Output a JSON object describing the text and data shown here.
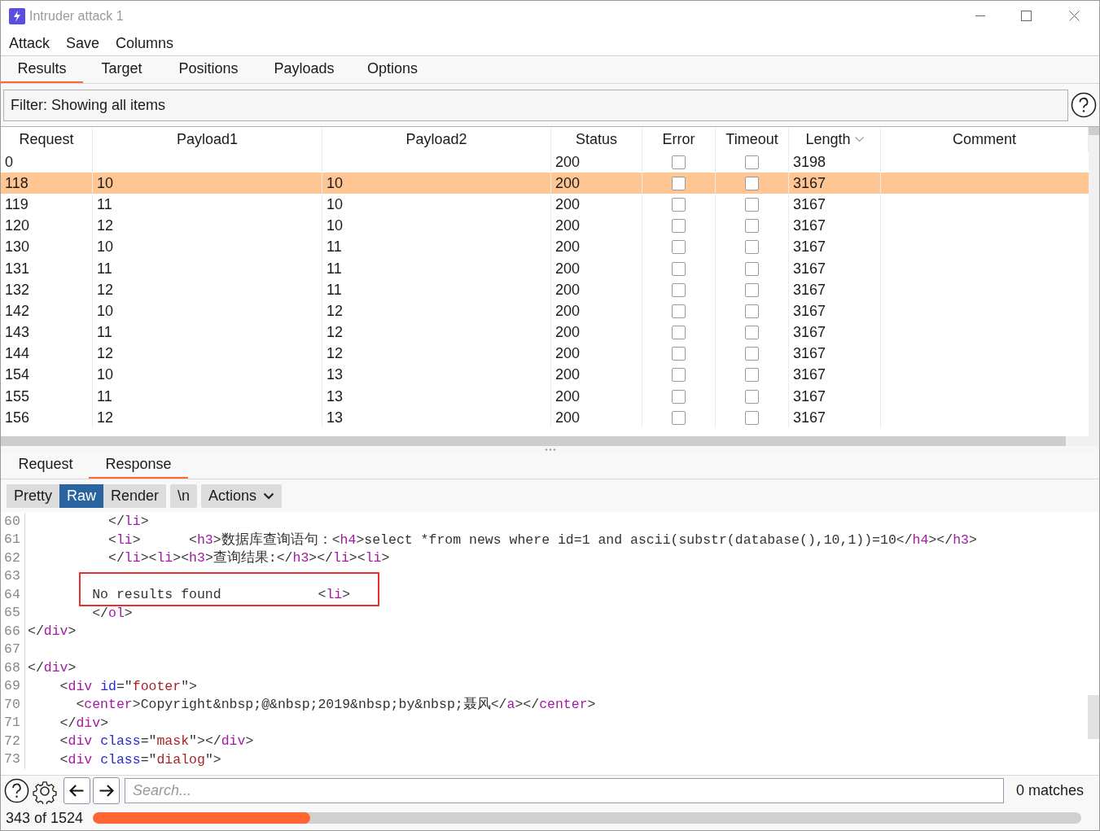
{
  "window": {
    "title": "Intruder attack 1"
  },
  "menu": [
    "Attack",
    "Save",
    "Columns"
  ],
  "tabs": [
    {
      "label": "Results",
      "selected": true
    },
    {
      "label": "Target",
      "selected": false
    },
    {
      "label": "Positions",
      "selected": false
    },
    {
      "label": "Payloads",
      "selected": false
    },
    {
      "label": "Options",
      "selected": false
    }
  ],
  "filter": {
    "label": "Filter: Showing all items"
  },
  "table": {
    "columns": [
      {
        "label": "Request",
        "sorted": false
      },
      {
        "label": "Payload1",
        "sorted": false
      },
      {
        "label": "Payload2",
        "sorted": false
      },
      {
        "label": "Status",
        "sorted": false
      },
      {
        "label": "Error",
        "sorted": false
      },
      {
        "label": "Timeout",
        "sorted": false
      },
      {
        "label": "Length",
        "sorted": true
      },
      {
        "label": "Comment",
        "sorted": false
      }
    ],
    "rows": [
      {
        "request": "0",
        "payload1": "",
        "payload2": "",
        "status": "200",
        "error": false,
        "timeout": false,
        "length": "3198",
        "selected": false
      },
      {
        "request": "118",
        "payload1": "10",
        "payload2": "10",
        "status": "200",
        "error": false,
        "timeout": false,
        "length": "3167",
        "selected": true
      },
      {
        "request": "119",
        "payload1": "11",
        "payload2": "10",
        "status": "200",
        "error": false,
        "timeout": false,
        "length": "3167",
        "selected": false
      },
      {
        "request": "120",
        "payload1": "12",
        "payload2": "10",
        "status": "200",
        "error": false,
        "timeout": false,
        "length": "3167",
        "selected": false
      },
      {
        "request": "130",
        "payload1": "10",
        "payload2": "11",
        "status": "200",
        "error": false,
        "timeout": false,
        "length": "3167",
        "selected": false
      },
      {
        "request": "131",
        "payload1": "11",
        "payload2": "11",
        "status": "200",
        "error": false,
        "timeout": false,
        "length": "3167",
        "selected": false
      },
      {
        "request": "132",
        "payload1": "12",
        "payload2": "11",
        "status": "200",
        "error": false,
        "timeout": false,
        "length": "3167",
        "selected": false
      },
      {
        "request": "142",
        "payload1": "10",
        "payload2": "12",
        "status": "200",
        "error": false,
        "timeout": false,
        "length": "3167",
        "selected": false
      },
      {
        "request": "143",
        "payload1": "11",
        "payload2": "12",
        "status": "200",
        "error": false,
        "timeout": false,
        "length": "3167",
        "selected": false
      },
      {
        "request": "144",
        "payload1": "12",
        "payload2": "12",
        "status": "200",
        "error": false,
        "timeout": false,
        "length": "3167",
        "selected": false
      },
      {
        "request": "154",
        "payload1": "10",
        "payload2": "13",
        "status": "200",
        "error": false,
        "timeout": false,
        "length": "3167",
        "selected": false
      },
      {
        "request": "155",
        "payload1": "11",
        "payload2": "13",
        "status": "200",
        "error": false,
        "timeout": false,
        "length": "3167",
        "selected": false
      },
      {
        "request": "156",
        "payload1": "12",
        "payload2": "13",
        "status": "200",
        "error": false,
        "timeout": false,
        "length": "3167",
        "selected": false
      }
    ]
  },
  "message_tabs": [
    {
      "label": "Request",
      "selected": false
    },
    {
      "label": "Response",
      "selected": true
    }
  ],
  "view_buttons": [
    {
      "label": "Pretty",
      "selected": false
    },
    {
      "label": "Raw",
      "selected": true
    },
    {
      "label": "Render",
      "selected": false
    }
  ],
  "newline_button": "\\n",
  "actions_button": "Actions",
  "code_lines": [
    {
      "number": "60",
      "highlighted": false,
      "tokens": [
        {
          "kind": "plain",
          "text": "          </"
        },
        {
          "kind": "tag",
          "text": "li"
        },
        {
          "kind": "plain",
          "text": ">"
        }
      ]
    },
    {
      "number": "61",
      "highlighted": false,
      "tokens": [
        {
          "kind": "plain",
          "text": "          <"
        },
        {
          "kind": "tag",
          "text": "li"
        },
        {
          "kind": "plain",
          "text": ">      <"
        },
        {
          "kind": "tag",
          "text": "h3"
        },
        {
          "kind": "plain",
          "text": ">数据库查询语句：<"
        },
        {
          "kind": "tag",
          "text": "h4"
        },
        {
          "kind": "plain",
          "text": ">select *from news where id=1 and ascii(substr(database(),10,1))=10</"
        },
        {
          "kind": "tag",
          "text": "h4"
        },
        {
          "kind": "plain",
          "text": "></"
        },
        {
          "kind": "tag",
          "text": "h3"
        },
        {
          "kind": "plain",
          "text": ">"
        }
      ]
    },
    {
      "number": "62",
      "highlighted": false,
      "tokens": [
        {
          "kind": "plain",
          "text": "          </"
        },
        {
          "kind": "tag",
          "text": "li"
        },
        {
          "kind": "plain",
          "text": "><"
        },
        {
          "kind": "tag",
          "text": "li"
        },
        {
          "kind": "plain",
          "text": "><"
        },
        {
          "kind": "tag",
          "text": "h3"
        },
        {
          "kind": "plain",
          "text": ">查询结果:</"
        },
        {
          "kind": "tag",
          "text": "h3"
        },
        {
          "kind": "plain",
          "text": "></"
        },
        {
          "kind": "tag",
          "text": "li"
        },
        {
          "kind": "plain",
          "text": "><"
        },
        {
          "kind": "tag",
          "text": "li"
        },
        {
          "kind": "plain",
          "text": ">"
        }
      ]
    },
    {
      "number": "63",
      "highlighted": false
    },
    {
      "number": "64",
      "highlighted": true,
      "tokens": [
        {
          "kind": "plain",
          "text": "        No results found            <"
        },
        {
          "kind": "tag",
          "text": "li"
        },
        {
          "kind": "plain",
          "text": ">"
        }
      ]
    },
    {
      "number": "65",
      "highlighted": false,
      "tokens": [
        {
          "kind": "plain",
          "text": "        </"
        },
        {
          "kind": "tag",
          "text": "ol"
        },
        {
          "kind": "plain",
          "text": ">"
        }
      ]
    },
    {
      "number": "66",
      "highlighted": false,
      "tokens": [
        {
          "kind": "plain",
          "text": "</"
        },
        {
          "kind": "tag",
          "text": "div"
        },
        {
          "kind": "plain",
          "text": ">"
        }
      ]
    },
    {
      "number": "67",
      "highlighted": false
    },
    {
      "number": "68",
      "highlighted": false,
      "tokens": [
        {
          "kind": "plain",
          "text": "</"
        },
        {
          "kind": "tag",
          "text": "div"
        },
        {
          "kind": "plain",
          "text": ">"
        }
      ]
    },
    {
      "number": "69",
      "highlighted": false,
      "tokens": [
        {
          "kind": "plain",
          "text": "    <"
        },
        {
          "kind": "tag",
          "text": "div"
        },
        {
          "kind": "attr",
          "text": " id"
        },
        {
          "kind": "plain",
          "text": "=\""
        },
        {
          "kind": "value",
          "text": "footer"
        },
        {
          "kind": "plain",
          "text": "\">"
        }
      ]
    },
    {
      "number": "70",
      "highlighted": false,
      "tokens": [
        {
          "kind": "plain",
          "text": "      <"
        },
        {
          "kind": "tag",
          "text": "center"
        },
        {
          "kind": "plain",
          "text": ">Copyright&nbsp;@&nbsp;2019&nbsp;by&nbsp;聂风</"
        },
        {
          "kind": "tag",
          "text": "a"
        },
        {
          "kind": "plain",
          "text": "></"
        },
        {
          "kind": "tag",
          "text": "center"
        },
        {
          "kind": "plain",
          "text": ">"
        }
      ]
    },
    {
      "number": "71",
      "highlighted": false,
      "tokens": [
        {
          "kind": "plain",
          "text": "    </"
        },
        {
          "kind": "tag",
          "text": "div"
        },
        {
          "kind": "plain",
          "text": ">"
        }
      ]
    },
    {
      "number": "72",
      "highlighted": false,
      "tokens": [
        {
          "kind": "plain",
          "text": "    <"
        },
        {
          "kind": "tag",
          "text": "div"
        },
        {
          "kind": "attr",
          "text": " class"
        },
        {
          "kind": "plain",
          "text": "=\""
        },
        {
          "kind": "value",
          "text": "mask"
        },
        {
          "kind": "plain",
          "text": "\"></"
        },
        {
          "kind": "tag",
          "text": "div"
        },
        {
          "kind": "plain",
          "text": ">"
        }
      ]
    },
    {
      "number": "73",
      "highlighted": false,
      "tokens": [
        {
          "kind": "plain",
          "text": "    <"
        },
        {
          "kind": "tag",
          "text": "div"
        },
        {
          "kind": "attr",
          "text": " class"
        },
        {
          "kind": "plain",
          "text": "=\""
        },
        {
          "kind": "value",
          "text": "dialog"
        },
        {
          "kind": "plain",
          "text": "\">"
        }
      ]
    }
  ],
  "search": {
    "placeholder": "Search...",
    "matches": "0 matches"
  },
  "status_bar": {
    "progress_text": "343 of 1524",
    "level": 0.22
  }
}
